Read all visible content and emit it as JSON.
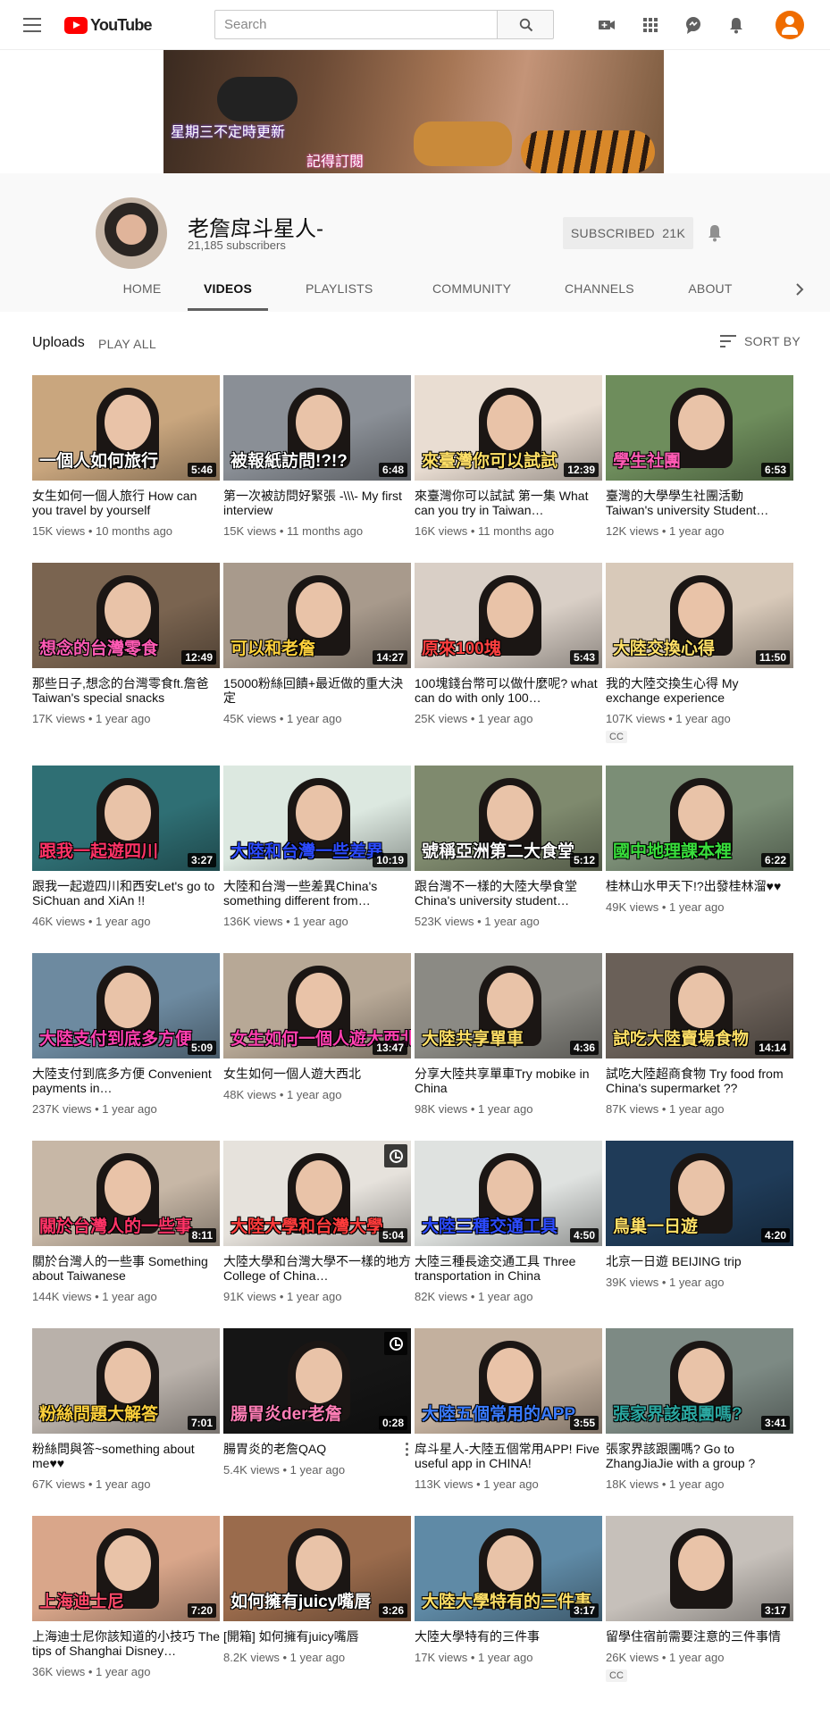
{
  "masthead": {
    "logo_text": "YouTube",
    "search_placeholder": "Search"
  },
  "banner": {
    "line1": "星期三不定時更新",
    "line2": "記得訂閱"
  },
  "channel": {
    "name": "老詹戽斗星人-",
    "subscribers": "21,185 subscribers",
    "subscribe_label": "SUBSCRIBED  21K"
  },
  "tabs": [
    "HOME",
    "VIDEOS",
    "PLAYLISTS",
    "COMMUNITY",
    "CHANNELS",
    "ABOUT"
  ],
  "active_tab": "VIDEOS",
  "section": {
    "title": "Uploads",
    "play_all": "PLAY ALL",
    "sort_by": "SORT BY"
  },
  "videos": [
    {
      "title": "女生如何一個人旅行 How can you travel by yourself",
      "meta": "15K views • 10 months ago",
      "duration": "5:46",
      "caption": "一個人如何旅行",
      "cap_color": "#ffffff",
      "bg": "#c9a67e",
      "cc": ""
    },
    {
      "title": "第一次被訪問好緊張 -\\\\\\- My first interview",
      "meta": "15K views • 11 months ago",
      "duration": "6:48",
      "caption": "被報紙訪問!?!?",
      "cap_color": "#ffffff",
      "bg": "#8a8f96",
      "cc": ""
    },
    {
      "title": "來臺灣你可以試試 第一集 What can you try in Taiwan…",
      "meta": "16K views • 11 months ago",
      "duration": "12:39",
      "caption": "來臺灣你可以試試",
      "cap_color": "#ffe066",
      "bg": "#e9ddd2",
      "cc": ""
    },
    {
      "title": "臺灣的大學學生社團活動 Taiwan's university Student…",
      "meta": "12K views • 1 year ago",
      "duration": "6:53",
      "caption": "學生社團",
      "cap_color": "#ff5ab4",
      "bg": "#6e8d5c",
      "cc": ""
    },
    {
      "title": "那些日子,想念的台灣零食ft.詹爸 Taiwan's special snacks",
      "meta": "17K views • 1 year ago",
      "duration": "12:49",
      "caption": "想念的台灣零食",
      "cap_color": "#ff5ab4",
      "bg": "#7a6450",
      "cc": ""
    },
    {
      "title": "15000粉絲回饋+最近做的重大決定",
      "meta": "45K views • 1 year ago",
      "duration": "14:27",
      "caption": "可以和老詹",
      "cap_color": "#ffd23c",
      "bg": "#a89a8c",
      "cc": ""
    },
    {
      "title": "100塊錢台幣可以做什麼呢? what can do with only 100…",
      "meta": "25K views • 1 year ago",
      "duration": "5:43",
      "caption": "原來100塊",
      "cap_color": "#ff4040",
      "bg": "#d9cfc6",
      "cc": ""
    },
    {
      "title": "我的大陸交換生心得 My exchange experience",
      "meta": "107K views • 1 year ago",
      "duration": "11:50",
      "caption": "大陸交換心得",
      "cap_color": "#ffe066",
      "bg": "#d8c9b9",
      "cc": "CC"
    },
    {
      "title": "跟我一起遊四川和西安Let's go to SiChuan and XiAn !!",
      "meta": "46K views • 1 year ago",
      "duration": "3:27",
      "caption": "跟我一起遊四川",
      "cap_color": "#ff3366",
      "bg": "#2f6f74",
      "cc": ""
    },
    {
      "title": "大陸和台灣一些差異China's something different from…",
      "meta": "136K views • 1 year ago",
      "duration": "10:19",
      "caption": "大陸和台灣一些差異",
      "cap_color": "#2c4bff",
      "bg": "#dce8e0",
      "cc": ""
    },
    {
      "title": "跟台灣不一樣的大陸大學食堂 China's university student…",
      "meta": "523K views • 1 year ago",
      "duration": "5:12",
      "caption": "號稱亞洲第二大食堂",
      "cap_color": "#ffffff",
      "bg": "#7f8a6e",
      "cc": ""
    },
    {
      "title": "桂林山水甲天下!?出發桂林溜♥♥",
      "meta": "49K views • 1 year ago",
      "duration": "6:22",
      "caption": "國中地理課本裡",
      "cap_color": "#39e03c",
      "bg": "#7b8e76",
      "cc": ""
    },
    {
      "title": "大陸支付到底多方便 Convenient payments in…",
      "meta": "237K views • 1 year ago",
      "duration": "5:09",
      "caption": "大陸支付到底多方便",
      "cap_color": "#ff3fb0",
      "bg": "#6d8aa0",
      "cc": ""
    },
    {
      "title": "女生如何一個人遊大西北",
      "meta": "48K views • 1 year ago",
      "duration": "13:47",
      "caption": "女生如何一個人遊大西北",
      "cap_color": "#ff3fb0",
      "bg": "#b7a896",
      "cc": ""
    },
    {
      "title": "分享大陸共享單車Try mobike in China",
      "meta": "98K views • 1 year ago",
      "duration": "4:36",
      "caption": "大陸共享單車",
      "cap_color": "#ffe066",
      "bg": "#8b8a84",
      "cc": ""
    },
    {
      "title": "試吃大陸超商食物 Try food from China's supermarket ??",
      "meta": "87K views • 1 year ago",
      "duration": "14:14",
      "caption": "試吃大陸賣場食物",
      "cap_color": "#ffe066",
      "bg": "#6a6058",
      "cc": ""
    },
    {
      "title": "關於台灣人的一些事 Something about Taiwanese",
      "meta": "144K views • 1 year ago",
      "duration": "8:11",
      "caption": "關於台灣人的一些事",
      "cap_color": "#ff3366",
      "bg": "#c7b7a6",
      "cc": ""
    },
    {
      "title": "大陸大學和台灣大學不一樣的地方 College of China…",
      "meta": "91K views • 1 year ago",
      "duration": "5:04",
      "caption": "大陸大學和台灣大學",
      "cap_color": "#ff3b3b",
      "bg": "#e6e2dc",
      "cc": "",
      "watch_later": true
    },
    {
      "title": "大陸三種長途交通工具 Three transportation in China",
      "meta": "82K views • 1 year ago",
      "duration": "4:50",
      "caption": "大陸三種交通工具",
      "cap_color": "#2c4bff",
      "bg": "#dfe2e0",
      "cc": ""
    },
    {
      "title": "北京一日遊 BEIJING trip",
      "meta": "39K views • 1 year ago",
      "duration": "4:20",
      "caption": "鳥巢一日遊",
      "cap_color": "#ffe066",
      "bg": "#1f3b58",
      "cc": ""
    },
    {
      "title": "粉絲問與答~something about me♥♥",
      "meta": "67K views • 1 year ago",
      "duration": "7:01",
      "caption": "粉絲問題大解答",
      "cap_color": "#ffd23c",
      "bg": "#b9b1aa",
      "cc": ""
    },
    {
      "title": "腸胃炎的老詹QAQ",
      "meta": "5.4K views • 1 year ago",
      "duration": "0:28",
      "caption": "腸胃炎der老詹",
      "cap_color": "#ff7eb6",
      "bg": "#151515",
      "cc": "",
      "watch_later": true,
      "kebab": true
    },
    {
      "title": "戽斗星人-大陸五個常用APP! Five useful app in CHINA!",
      "meta": "113K views • 1 year ago",
      "duration": "3:55",
      "caption": "大陸五個常用的APP",
      "cap_color": "#3a7bff",
      "bg": "#c3b09e",
      "cc": ""
    },
    {
      "title": "張家界該跟團嗎? Go to ZhangJiaJie with a group ?",
      "meta": "18K views • 1 year ago",
      "duration": "3:41",
      "caption": "張家界該跟團嗎?",
      "cap_color": "#2aa7a0",
      "bg": "#7d8a84",
      "cc": ""
    },
    {
      "title": "上海迪士尼你該知道的小技巧 The tips of Shanghai Disney…",
      "meta": "36K views • 1 year ago",
      "duration": "7:20",
      "caption": "上海迪士尼",
      "cap_color": "#ff4a6a",
      "bg": "#d9a68a",
      "cc": ""
    },
    {
      "title": "[開箱] 如何擁有juicy嘴唇",
      "meta": "8.2K views • 1 year ago",
      "duration": "3:26",
      "caption": "如何擁有juicy嘴唇",
      "cap_color": "#ffffff",
      "bg": "#9a6b4c",
      "cc": ""
    },
    {
      "title": "大陸大學特有的三件事",
      "meta": "17K views • 1 year ago",
      "duration": "3:17",
      "caption": "大陸大學特有的三件事",
      "cap_color": "#ffe066",
      "bg": "#5f8aa6",
      "cc": ""
    },
    {
      "title": "留學住宿前需要注意的三件事情",
      "meta": "26K views • 1 year ago",
      "duration": "3:17",
      "caption": "",
      "cap_color": "#ffffff",
      "bg": "#c6c0ba",
      "cc": "CC"
    }
  ]
}
